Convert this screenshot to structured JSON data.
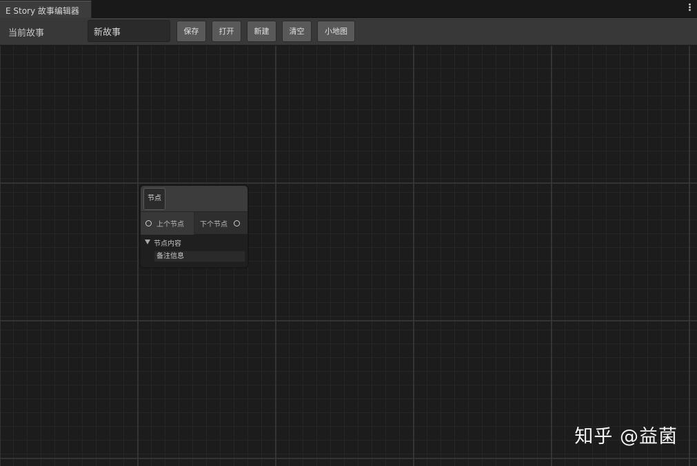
{
  "window": {
    "tab_title": "E Story 故事编辑器",
    "menu_icon": "kebab-menu-icon"
  },
  "toolbar": {
    "current_story_label": "当前故事",
    "story_name_value": "新故事",
    "save_label": "保存",
    "open_label": "打开",
    "new_label": "新建",
    "clear_label": "清空",
    "minimap_label": "小地图"
  },
  "node": {
    "title": "节点",
    "input_port_label": "上个节点",
    "output_port_label": "下个节点",
    "foldout_label": "节点内容",
    "note_value": "备注信息"
  },
  "watermark": {
    "text": "知乎 @益菌"
  },
  "colors": {
    "background": "#1c1c1c",
    "toolbar": "#383838",
    "button": "#595959",
    "node_header": "#3c3c3c"
  }
}
